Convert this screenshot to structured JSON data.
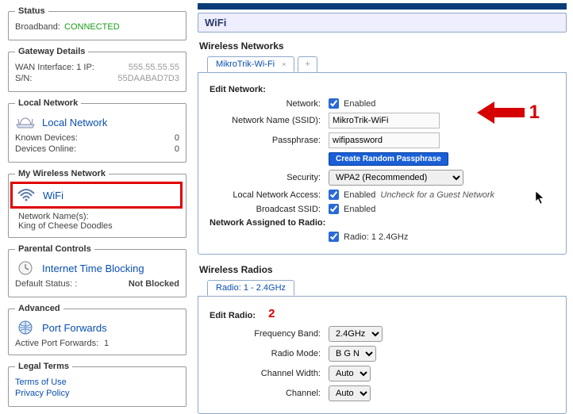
{
  "status": {
    "legend": "Status",
    "broadband_label": "Broadband:",
    "broadband_value": "CONNECTED"
  },
  "gateway": {
    "legend": "Gateway Details",
    "wan_label": "WAN Interface: 1 IP:",
    "wan_value": "555.55.55.55",
    "sn_label": "S/N:",
    "sn_value": "55DAABAD7D3"
  },
  "localnet": {
    "legend": "Local Network",
    "title": "Local Network",
    "known_label": "Known Devices:",
    "known_value": "0",
    "online_label": "Devices Online:",
    "online_value": "0"
  },
  "mywifi": {
    "legend": "My Wireless Network",
    "title": "WiFi",
    "names_label": "Network Name(s):",
    "names_value": "King of Cheese Doodles"
  },
  "parental": {
    "legend": "Parental Controls",
    "title": "Internet Time Blocking",
    "status_label": "Default Status: :",
    "status_value": "Not Blocked"
  },
  "advanced": {
    "legend": "Advanced",
    "title": "Port Forwards",
    "active_label": "Active Port Forwards:",
    "active_value": "1"
  },
  "legal": {
    "legend": "Legal Terms",
    "terms": "Terms of Use",
    "privacy": "Privacy Policy"
  },
  "page": {
    "title": "WiFi"
  },
  "networks": {
    "heading": "Wireless Networks",
    "tab1": "MikroTrik-Wi-Fi",
    "add": "+",
    "edit_heading": "Edit Network:",
    "network_label": "Network:",
    "enabled_text": "Enabled",
    "ssid_label": "Network Name (SSID):",
    "ssid_value": "MikroTrik-WiFi",
    "pass_label": "Passphrase:",
    "pass_value": "wifipassword",
    "randbtn": "Create Random Passphrase",
    "security_label": "Security:",
    "security_value": "WPA2 (Recommended)",
    "lna_label": "Local Network Access:",
    "lna_hint": "Uncheck for a Guest Network",
    "bcast_label": "Broadcast SSID:",
    "assigned_label": "Network Assigned to Radio:",
    "radio_assign": "Radio:  1   2.4GHz"
  },
  "radios": {
    "heading": "Wireless Radios",
    "tab1": "Radio: 1 - 2.4GHz",
    "edit_heading": "Edit Radio:",
    "freq_label": "Frequency Band:",
    "freq_value": "2.4GHz",
    "mode_label": "Radio Mode:",
    "mode_value": "B G N",
    "width_label": "Channel Width:",
    "width_value": "Auto",
    "channel_label": "Channel:",
    "channel_value": "Auto"
  },
  "annotation": {
    "one": "1",
    "two": "2"
  }
}
